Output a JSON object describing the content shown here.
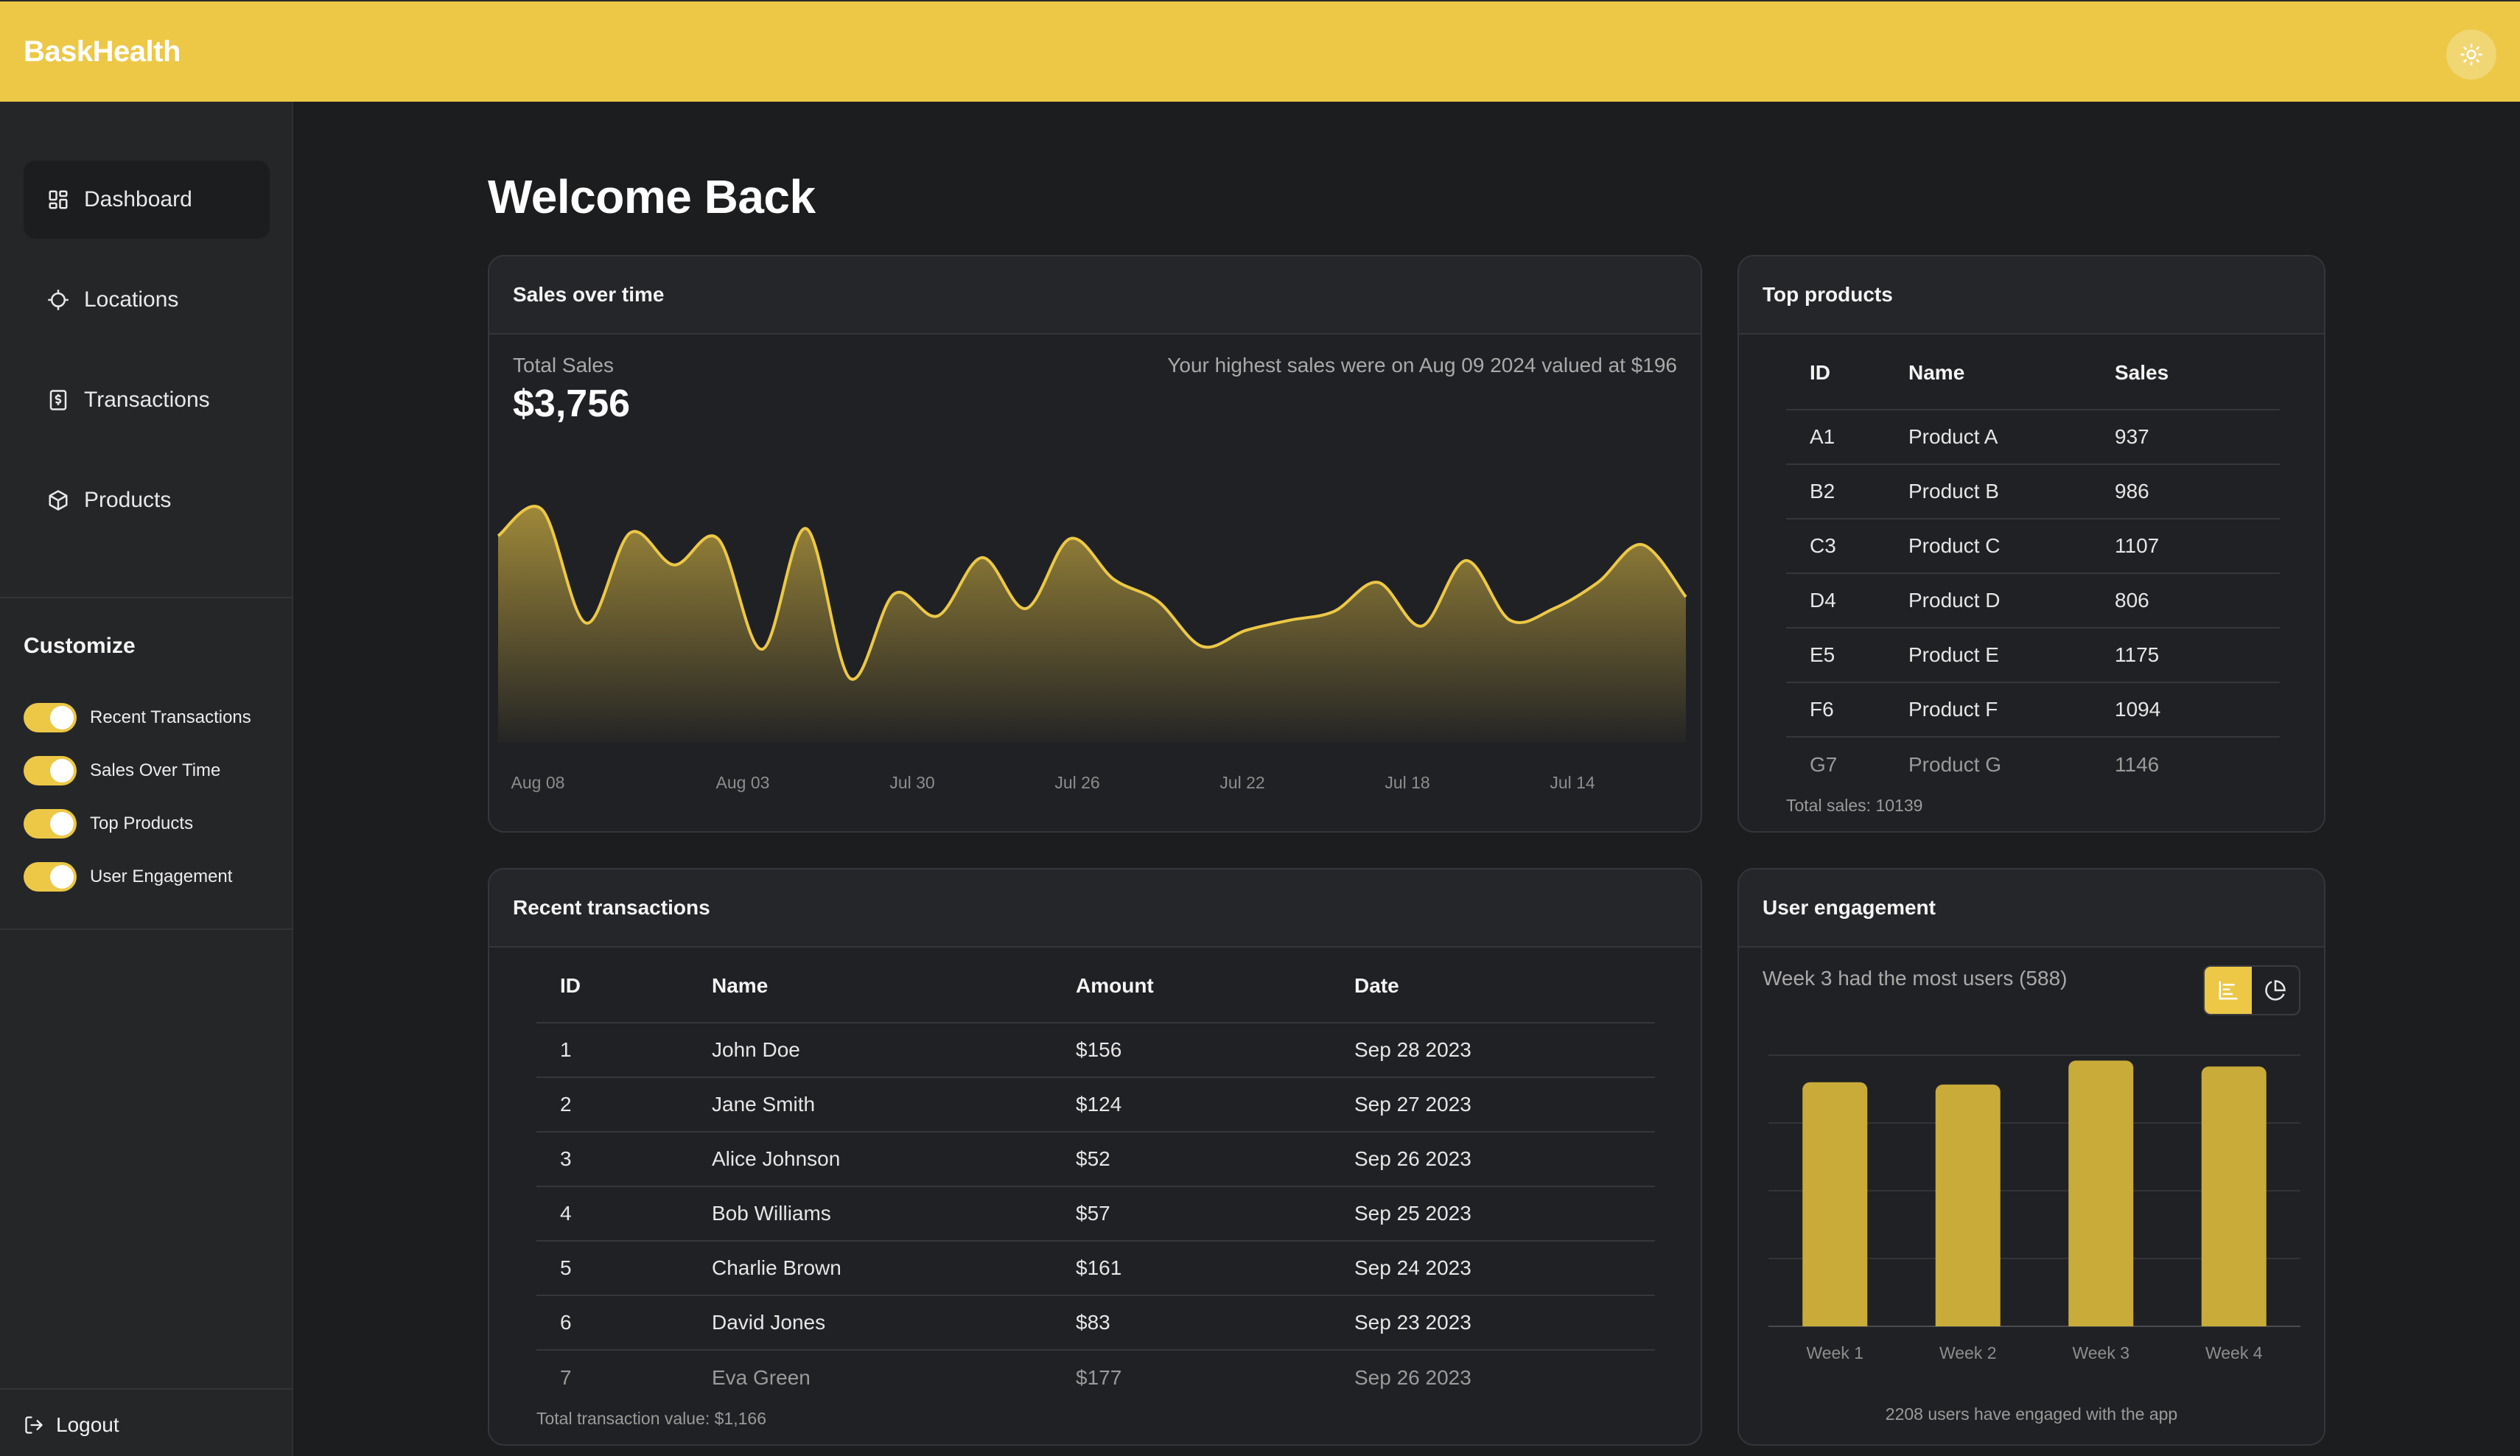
{
  "app": {
    "brand": "BaskHealth"
  },
  "sidebar": {
    "items": [
      {
        "label": "Dashboard",
        "icon": "dashboard-grid-icon",
        "active": true
      },
      {
        "label": "Locations",
        "icon": "crosshair-icon",
        "active": false
      },
      {
        "label": "Transactions",
        "icon": "receipt-dollar-icon",
        "active": false
      },
      {
        "label": "Products",
        "icon": "box-icon",
        "active": false
      }
    ],
    "customize_title": "Customize",
    "toggles": [
      {
        "label": "Recent Transactions",
        "on": true
      },
      {
        "label": "Sales Over Time",
        "on": true
      },
      {
        "label": "Top Products",
        "on": true
      },
      {
        "label": "User Engagement",
        "on": true
      }
    ],
    "logout_label": "Logout"
  },
  "main": {
    "title": "Welcome Back"
  },
  "sales": {
    "title": "Sales over time",
    "total_label": "Total Sales",
    "total_value": "$3,756",
    "highlight": "Your highest sales were on Aug 09 2024 valued at $196"
  },
  "top_products": {
    "title": "Top products",
    "headers": [
      "ID",
      "Name",
      "Sales"
    ],
    "rows": [
      [
        "A1",
        "Product A",
        "937"
      ],
      [
        "B2",
        "Product B",
        "986"
      ],
      [
        "C3",
        "Product C",
        "1107"
      ],
      [
        "D4",
        "Product D",
        "806"
      ],
      [
        "E5",
        "Product E",
        "1175"
      ],
      [
        "F6",
        "Product F",
        "1094"
      ],
      [
        "G7",
        "Product G",
        "1146"
      ]
    ],
    "footer": "Total sales: 10139"
  },
  "transactions": {
    "title": "Recent transactions",
    "headers": [
      "ID",
      "Name",
      "Amount",
      "Date"
    ],
    "rows": [
      [
        "1",
        "John Doe",
        "$156",
        "Sep 28 2023"
      ],
      [
        "2",
        "Jane Smith",
        "$124",
        "Sep 27 2023"
      ],
      [
        "3",
        "Alice Johnson",
        "$52",
        "Sep 26 2023"
      ],
      [
        "4",
        "Bob Williams",
        "$57",
        "Sep 25 2023"
      ],
      [
        "5",
        "Charlie Brown",
        "$161",
        "Sep 24 2023"
      ],
      [
        "6",
        "David Jones",
        "$83",
        "Sep 23 2023"
      ],
      [
        "7",
        "Eva Green",
        "$177",
        "Sep 26 2023"
      ]
    ],
    "footer": "Total transaction value: $1,166"
  },
  "engagement": {
    "title": "User engagement",
    "headline": "Week 3 had the most users (588)",
    "footer": "2208 users have engaged with the app",
    "view_buttons": [
      {
        "icon": "bar-chart-icon",
        "active": true
      },
      {
        "icon": "pie-chart-icon",
        "active": false
      }
    ]
  },
  "colors": {
    "accent": "#ecc846",
    "background": "#1c1d1f",
    "card": "#202124"
  },
  "chart_data": [
    {
      "type": "area",
      "x": [
        "Aug 08",
        "Aug 03",
        "Jul 30",
        "Jul 26",
        "Jul 22",
        "Jul 18",
        "Jul 14"
      ],
      "series": [
        {
          "values": [
            170,
            188,
            110,
            172,
            150,
            168,
            92,
            175,
            72,
            130,
            115,
            155,
            120,
            168,
            140,
            125,
            94,
            105,
            112,
            118,
            138,
            108,
            153,
            112,
            120,
            138,
            164,
            128
          ]
        }
      ],
      "xlabel": "",
      "ylabel": "",
      "ylim": [
        50,
        200
      ],
      "grid": false
    },
    {
      "type": "bar",
      "categories": [
        "Week 1",
        "Week 2",
        "Week 3",
        "Week 4"
      ],
      "values": [
        540,
        535,
        588,
        575
      ],
      "ylim": [
        0,
        600
      ],
      "grid": true
    }
  ]
}
